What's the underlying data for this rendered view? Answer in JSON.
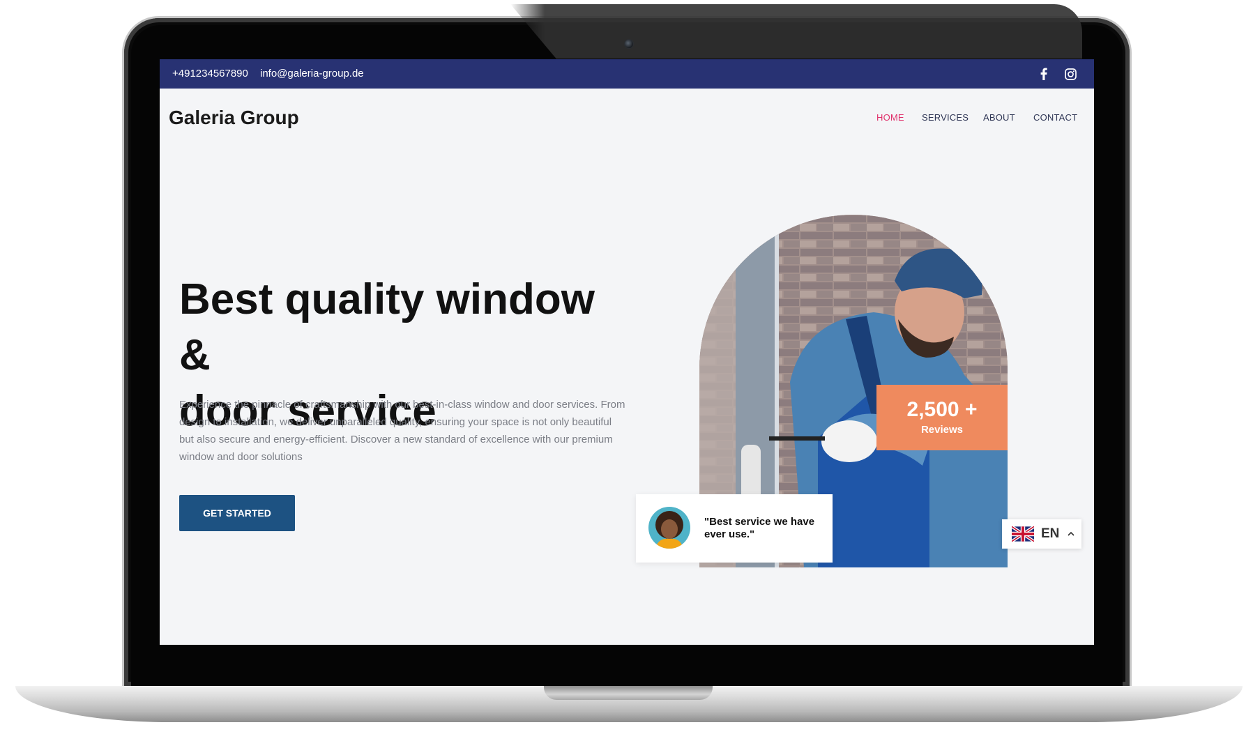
{
  "topbar": {
    "phone": "+491234567890",
    "email": "info@galeria-group.de",
    "social_icons": [
      "facebook-icon",
      "instagram-icon"
    ]
  },
  "header": {
    "logo": "Galeria Group",
    "nav": [
      {
        "label": "HOME",
        "active": true
      },
      {
        "label": "SERVICES",
        "active": false
      },
      {
        "label": "ABOUT",
        "active": false
      },
      {
        "label": "CONTACT",
        "active": false
      }
    ]
  },
  "hero": {
    "title_line1": "Best quality window &",
    "title_line2": "door service",
    "description": "Experience the pinnacle of craftsmanship with our best-in-class window and door services. From design to installation, we deliver unparalleled quality, ensuring your space is not only beautiful but also secure and energy-efficient. Discover a new standard of excellence with our premium window and door solutions",
    "cta_label": "GET STARTED"
  },
  "stats": {
    "reviews_count": "2,500 +",
    "reviews_label": "Reviews"
  },
  "testimonial": {
    "quote": "\"Best service we have ever use.\""
  },
  "language": {
    "code": "EN",
    "flag_icon": "uk-flag-icon"
  },
  "colors": {
    "topbar_bg": "#283273",
    "nav_active": "#e0306b",
    "cta_bg": "#1d5282",
    "reviews_bg": "#ef8a5e"
  }
}
